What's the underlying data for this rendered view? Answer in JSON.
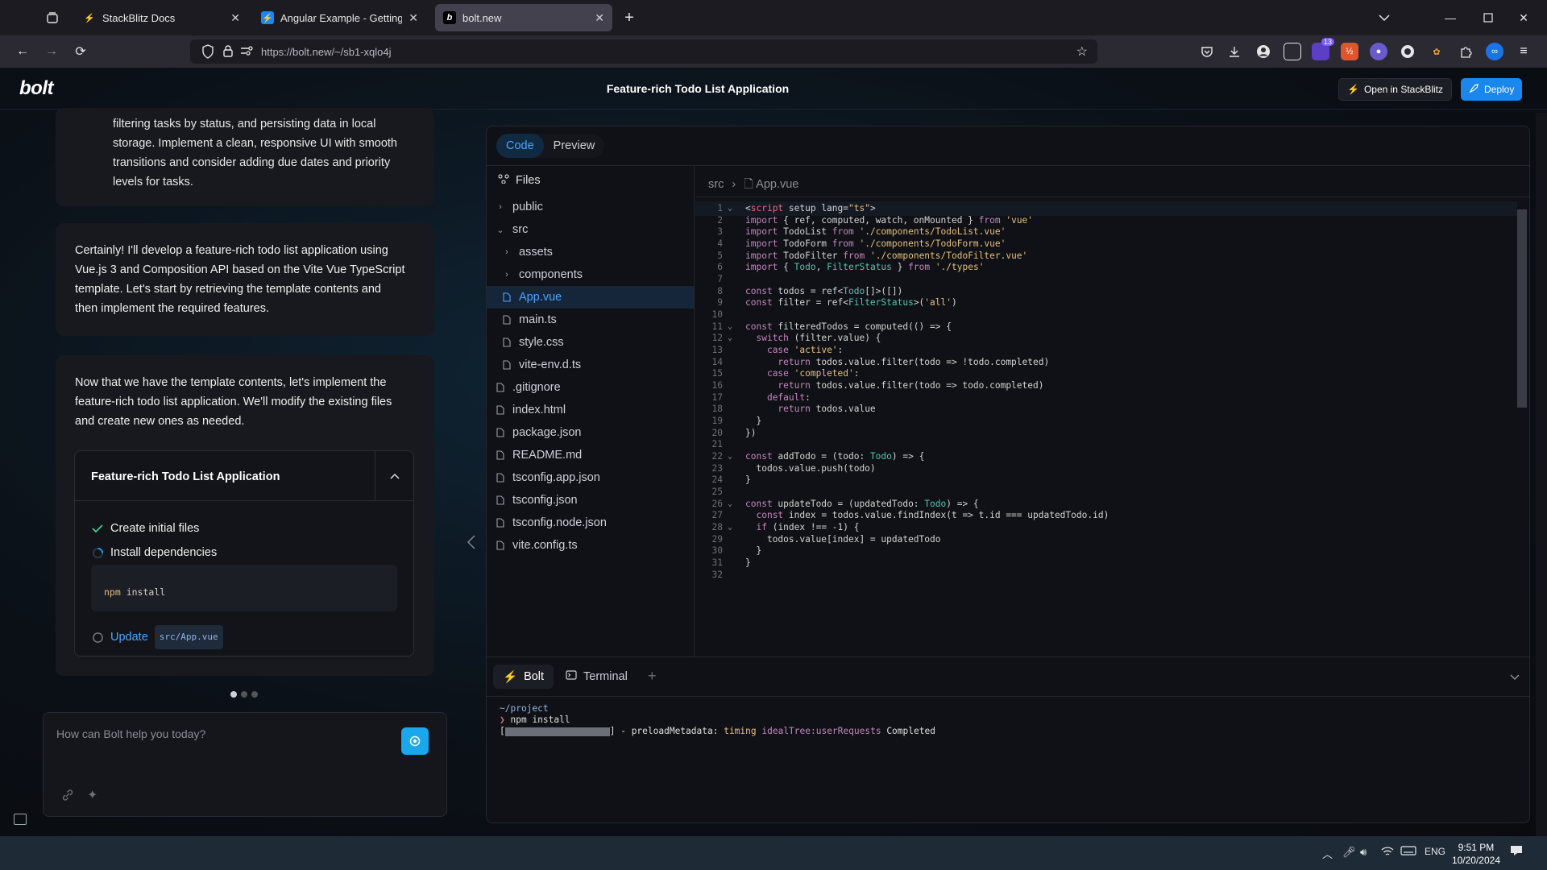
{
  "browser": {
    "tabs": [
      {
        "label": "StackBlitz Docs",
        "active": false
      },
      {
        "label": "Angular Example - Getting Start",
        "active": false
      },
      {
        "label": "bolt.new",
        "active": true
      }
    ],
    "url": "https://bolt.new/~/sb1-xqlo4j",
    "extension_badge": "13"
  },
  "app": {
    "logo": "bolt",
    "title": "Feature-rich Todo List Application",
    "open_stackblitz_label": "Open in StackBlitz",
    "deploy_label": "Deploy"
  },
  "chat": {
    "user_message_lines": [
      "filtering tasks by status, and persisting data in local",
      "storage. Implement a clean, responsive UI with smooth",
      "transitions and consider adding due dates and priority",
      "levels for tasks."
    ],
    "assistant_message_1_lines": [
      "Certainly! I'll develop a feature-rich todo list application using",
      "Vue.js 3 and Composition API based on the Vite Vue TypeScript",
      "template. Let's start by retrieving the template contents and",
      "then implement the required features."
    ],
    "assistant_message_2_lines": [
      "Now that we have the template contents, let's implement the",
      "feature-rich todo list application. We'll modify the existing files",
      "and create new ones as needed."
    ],
    "artifact": {
      "title": "Feature-rich Todo List Application",
      "steps": [
        {
          "label": "Create initial files",
          "status": "done"
        },
        {
          "label": "Install dependencies",
          "status": "running"
        },
        {
          "label": "Update",
          "file": "src/App.vue",
          "status": "pending"
        }
      ],
      "command_prefix": "npm",
      "command_rest": " install"
    },
    "prompt_placeholder": "How can Bolt help you today?"
  },
  "workbench": {
    "tabs": [
      {
        "label": "Code",
        "active": true
      },
      {
        "label": "Preview",
        "active": false
      }
    ],
    "files_label": "Files",
    "tree": [
      {
        "name": "public",
        "type": "folder",
        "depth": 0,
        "open": false
      },
      {
        "name": "src",
        "type": "folder",
        "depth": 0,
        "open": true
      },
      {
        "name": "assets",
        "type": "folder",
        "depth": 1,
        "open": false
      },
      {
        "name": "components",
        "type": "folder",
        "depth": 1,
        "open": false
      },
      {
        "name": "App.vue",
        "type": "file",
        "depth": 1,
        "selected": true
      },
      {
        "name": "main.ts",
        "type": "file",
        "depth": 1
      },
      {
        "name": "style.css",
        "type": "file",
        "depth": 1
      },
      {
        "name": "vite-env.d.ts",
        "type": "file",
        "depth": 1
      },
      {
        "name": ".gitignore",
        "type": "file",
        "depth": 0
      },
      {
        "name": "index.html",
        "type": "file",
        "depth": 0
      },
      {
        "name": "package.json",
        "type": "file",
        "depth": 0
      },
      {
        "name": "README.md",
        "type": "file",
        "depth": 0
      },
      {
        "name": "tsconfig.app.json",
        "type": "file",
        "depth": 0
      },
      {
        "name": "tsconfig.json",
        "type": "file",
        "depth": 0
      },
      {
        "name": "tsconfig.node.json",
        "type": "file",
        "depth": 0
      },
      {
        "name": "vite.config.ts",
        "type": "file",
        "depth": 0
      }
    ],
    "breadcrumb": {
      "folder": "src",
      "file": "App.vue"
    },
    "code_lines": [
      "<script setup lang=\"ts\">",
      "import { ref, computed, watch, onMounted } from 'vue'",
      "import TodoList from './components/TodoList.vue'",
      "import TodoForm from './components/TodoForm.vue'",
      "import TodoFilter from './components/TodoFilter.vue'",
      "import { Todo, FilterStatus } from './types'",
      "",
      "const todos = ref<Todo[]>([])",
      "const filter = ref<FilterStatus>('all')",
      "",
      "const filteredTodos = computed(() => {",
      "  switch (filter.value) {",
      "    case 'active':",
      "      return todos.value.filter(todo => !todo.completed)",
      "    case 'completed':",
      "      return todos.value.filter(todo => todo.completed)",
      "    default:",
      "      return todos.value",
      "  }",
      "})",
      "",
      "const addTodo = (todo: Todo) => {",
      "  todos.value.push(todo)",
      "}",
      "",
      "const updateTodo = (updatedTodo: Todo) => {",
      "  const index = todos.value.findIndex(t => t.id === updatedTodo.id)",
      "  if (index !== -1) {",
      "    todos.value[index] = updatedTodo",
      "  }",
      "}",
      ""
    ],
    "fold_lines": [
      1,
      11,
      12,
      22,
      26,
      28
    ],
    "terminal_tabs": [
      {
        "label": "Bolt",
        "active": true
      },
      {
        "label": "Terminal",
        "active": false
      }
    ],
    "terminal": {
      "cwd": "~/project",
      "command": "npm install",
      "progress_text_1": "] - preloadMetadata: ",
      "timing": "timing",
      "tree_request": "idealTree:userRequests",
      "completed": "Completed"
    }
  },
  "taskbar": {
    "lang": "ENG",
    "time": "9:51 PM",
    "date": "10/20/2024"
  },
  "colors": {
    "accent": "#1aa7ec",
    "link": "#4da3ff"
  }
}
